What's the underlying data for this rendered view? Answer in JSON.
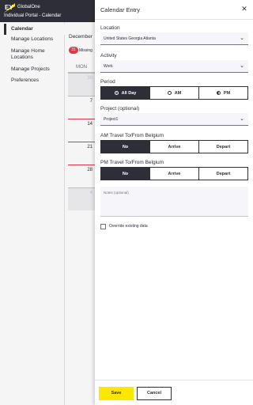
{
  "header": {
    "logo_text": "EY",
    "app_name": "GlobalOne",
    "subtitle": "Individual Portal - Calendar"
  },
  "sidebar": {
    "items": [
      {
        "label": "Calendar",
        "active": true
      },
      {
        "label": "Manage Locations"
      },
      {
        "label": "Manage Home Locations"
      },
      {
        "label": "Manage Projects"
      },
      {
        "label": "Preferences"
      }
    ]
  },
  "calendar": {
    "month_label": "December",
    "missing_count": "31",
    "missing_label": "Missing",
    "day_header": "MON",
    "days": [
      "30",
      "7",
      "14",
      "21",
      "28",
      "4"
    ]
  },
  "panel": {
    "title": "Calendar Entry",
    "close_icon": "close-icon",
    "location": {
      "label": "Location",
      "value": "United States Georgia Atlanta"
    },
    "activity": {
      "label": "Activity",
      "value": "Work"
    },
    "period": {
      "label": "Period",
      "options": [
        "All Day",
        "AM",
        "PM"
      ],
      "selected": "All Day"
    },
    "project": {
      "label": "Project (optional)",
      "value": "Project1"
    },
    "am_travel": {
      "label": "AM Travel To/From Belgium",
      "options": [
        "No",
        "Arrive",
        "Depart"
      ],
      "selected": "No"
    },
    "pm_travel": {
      "label": "PM Travel To/From Belgium",
      "options": [
        "No",
        "Arrive",
        "Depart"
      ],
      "selected": "No"
    },
    "notes": {
      "placeholder": "Notes (optional)"
    },
    "override": {
      "label": "Override existing data",
      "checked": false
    },
    "save_label": "Save",
    "cancel_label": "Cancel"
  },
  "colors": {
    "accent": "#ffe600",
    "dark": "#2e2e38",
    "alert": "#e53c4c"
  }
}
